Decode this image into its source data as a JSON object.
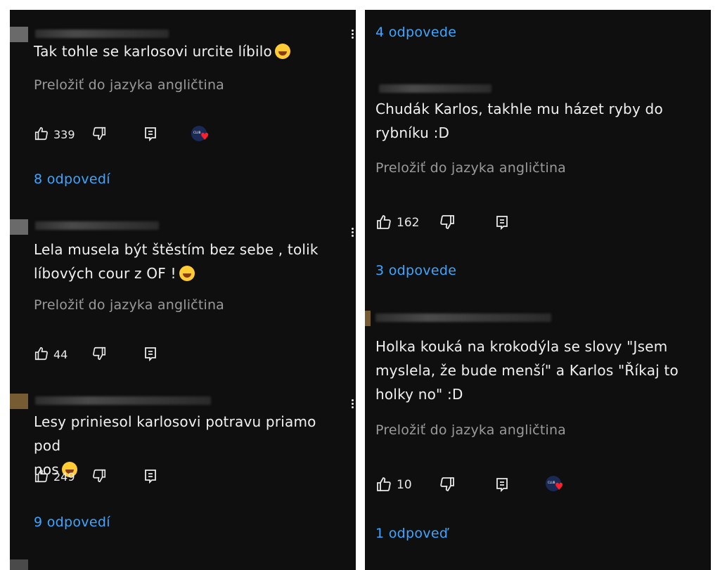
{
  "left_panel": {
    "comments": [
      {
        "text": "Tak tohle se karlosovi urcite líbilo",
        "emoji": "grinning-sweat-emoji",
        "translate": "Preložiť do jazyka angličtina",
        "likes": "339",
        "has_creator_heart": true,
        "replies": "8 odpovedí"
      },
      {
        "text_line1": "Lela musela být štěstím bez sebe , tolik",
        "text_line2": "líbových cour z OF !",
        "emoji": "rofl-emoji",
        "translate": "Preložiť do jazyka angličtina",
        "likes": "44",
        "has_creator_heart": false,
        "replies": ""
      },
      {
        "text_line1": "Lesy priniesol karlosovi potravu priamo pod",
        "text_line2": "nos",
        "emoji": "grinning-sweat-emoji",
        "translate": "",
        "likes": "249",
        "has_creator_heart": false,
        "replies": "9 odpovedí"
      }
    ]
  },
  "right_panel": {
    "top_replies": "4 odpovede",
    "comments": [
      {
        "text_line1": "Chudák Karlos, takhle mu házet ryby do",
        "text_line2": "rybníku :D",
        "translate": "Preložiť do jazyka angličtina",
        "likes": "162",
        "has_creator_heart": false,
        "replies": "3 odpovede"
      },
      {
        "text_line1": "Holka kouká na krokodýla se slovy \"Jsem",
        "text_line2": "myslela, že bude menší\" a Karlos \"Říkaj to",
        "text_line3": "holky no\" :D",
        "translate": "Preložiť do jazyka angličtina",
        "likes": "10",
        "has_creator_heart": true,
        "replies": "1 odpoveď"
      }
    ]
  },
  "colors": {
    "background": "#0f0f0f",
    "text": "#f1f1f1",
    "secondary_text": "#9a9a9a",
    "link_blue": "#3ea6ff",
    "heart_red": "#ff1e2d"
  }
}
